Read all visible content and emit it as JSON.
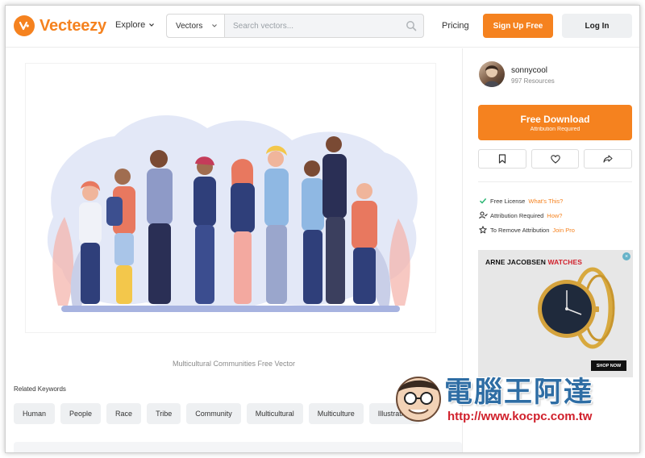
{
  "header": {
    "logo": "Vecteezy",
    "explore_label": "Explore",
    "search_type": "Vectors",
    "search_placeholder": "Search vectors...",
    "pricing_label": "Pricing",
    "signup_label": "Sign Up Free",
    "login_label": "Log In"
  },
  "main": {
    "caption": "Multicultural Communities Free Vector",
    "related_title": "Related Keywords",
    "keywords": [
      "Human",
      "People",
      "Race",
      "Tribe",
      "Community",
      "Multicultural",
      "Multiculture",
      "Illustration"
    ]
  },
  "sidebar": {
    "username": "sonnycool",
    "resources": "997 Resources",
    "download_title": "Free Download",
    "download_sub": "Attribution Required",
    "license": [
      {
        "label": "Free License",
        "link": "What's This?",
        "icon": "check-icon"
      },
      {
        "label": "Attribution Required",
        "link": "How?",
        "icon": "user-check-icon"
      },
      {
        "label": "To Remove Attribution",
        "link": "Join Pro",
        "icon": "star-icon"
      }
    ],
    "ad": {
      "brand_black": "ARNE JACOBSEN ",
      "brand_red": "WATCHES",
      "shop_label": "SHOP NOW",
      "close_glyph": "×"
    }
  },
  "watermark": {
    "name": "電腦王阿達",
    "url": "http://www.kocpc.com.tw"
  },
  "colors": {
    "accent": "#f5821f",
    "button_gray": "#eef0f2",
    "watermark_blue": "#2e6da4",
    "watermark_red": "#d0202b"
  }
}
